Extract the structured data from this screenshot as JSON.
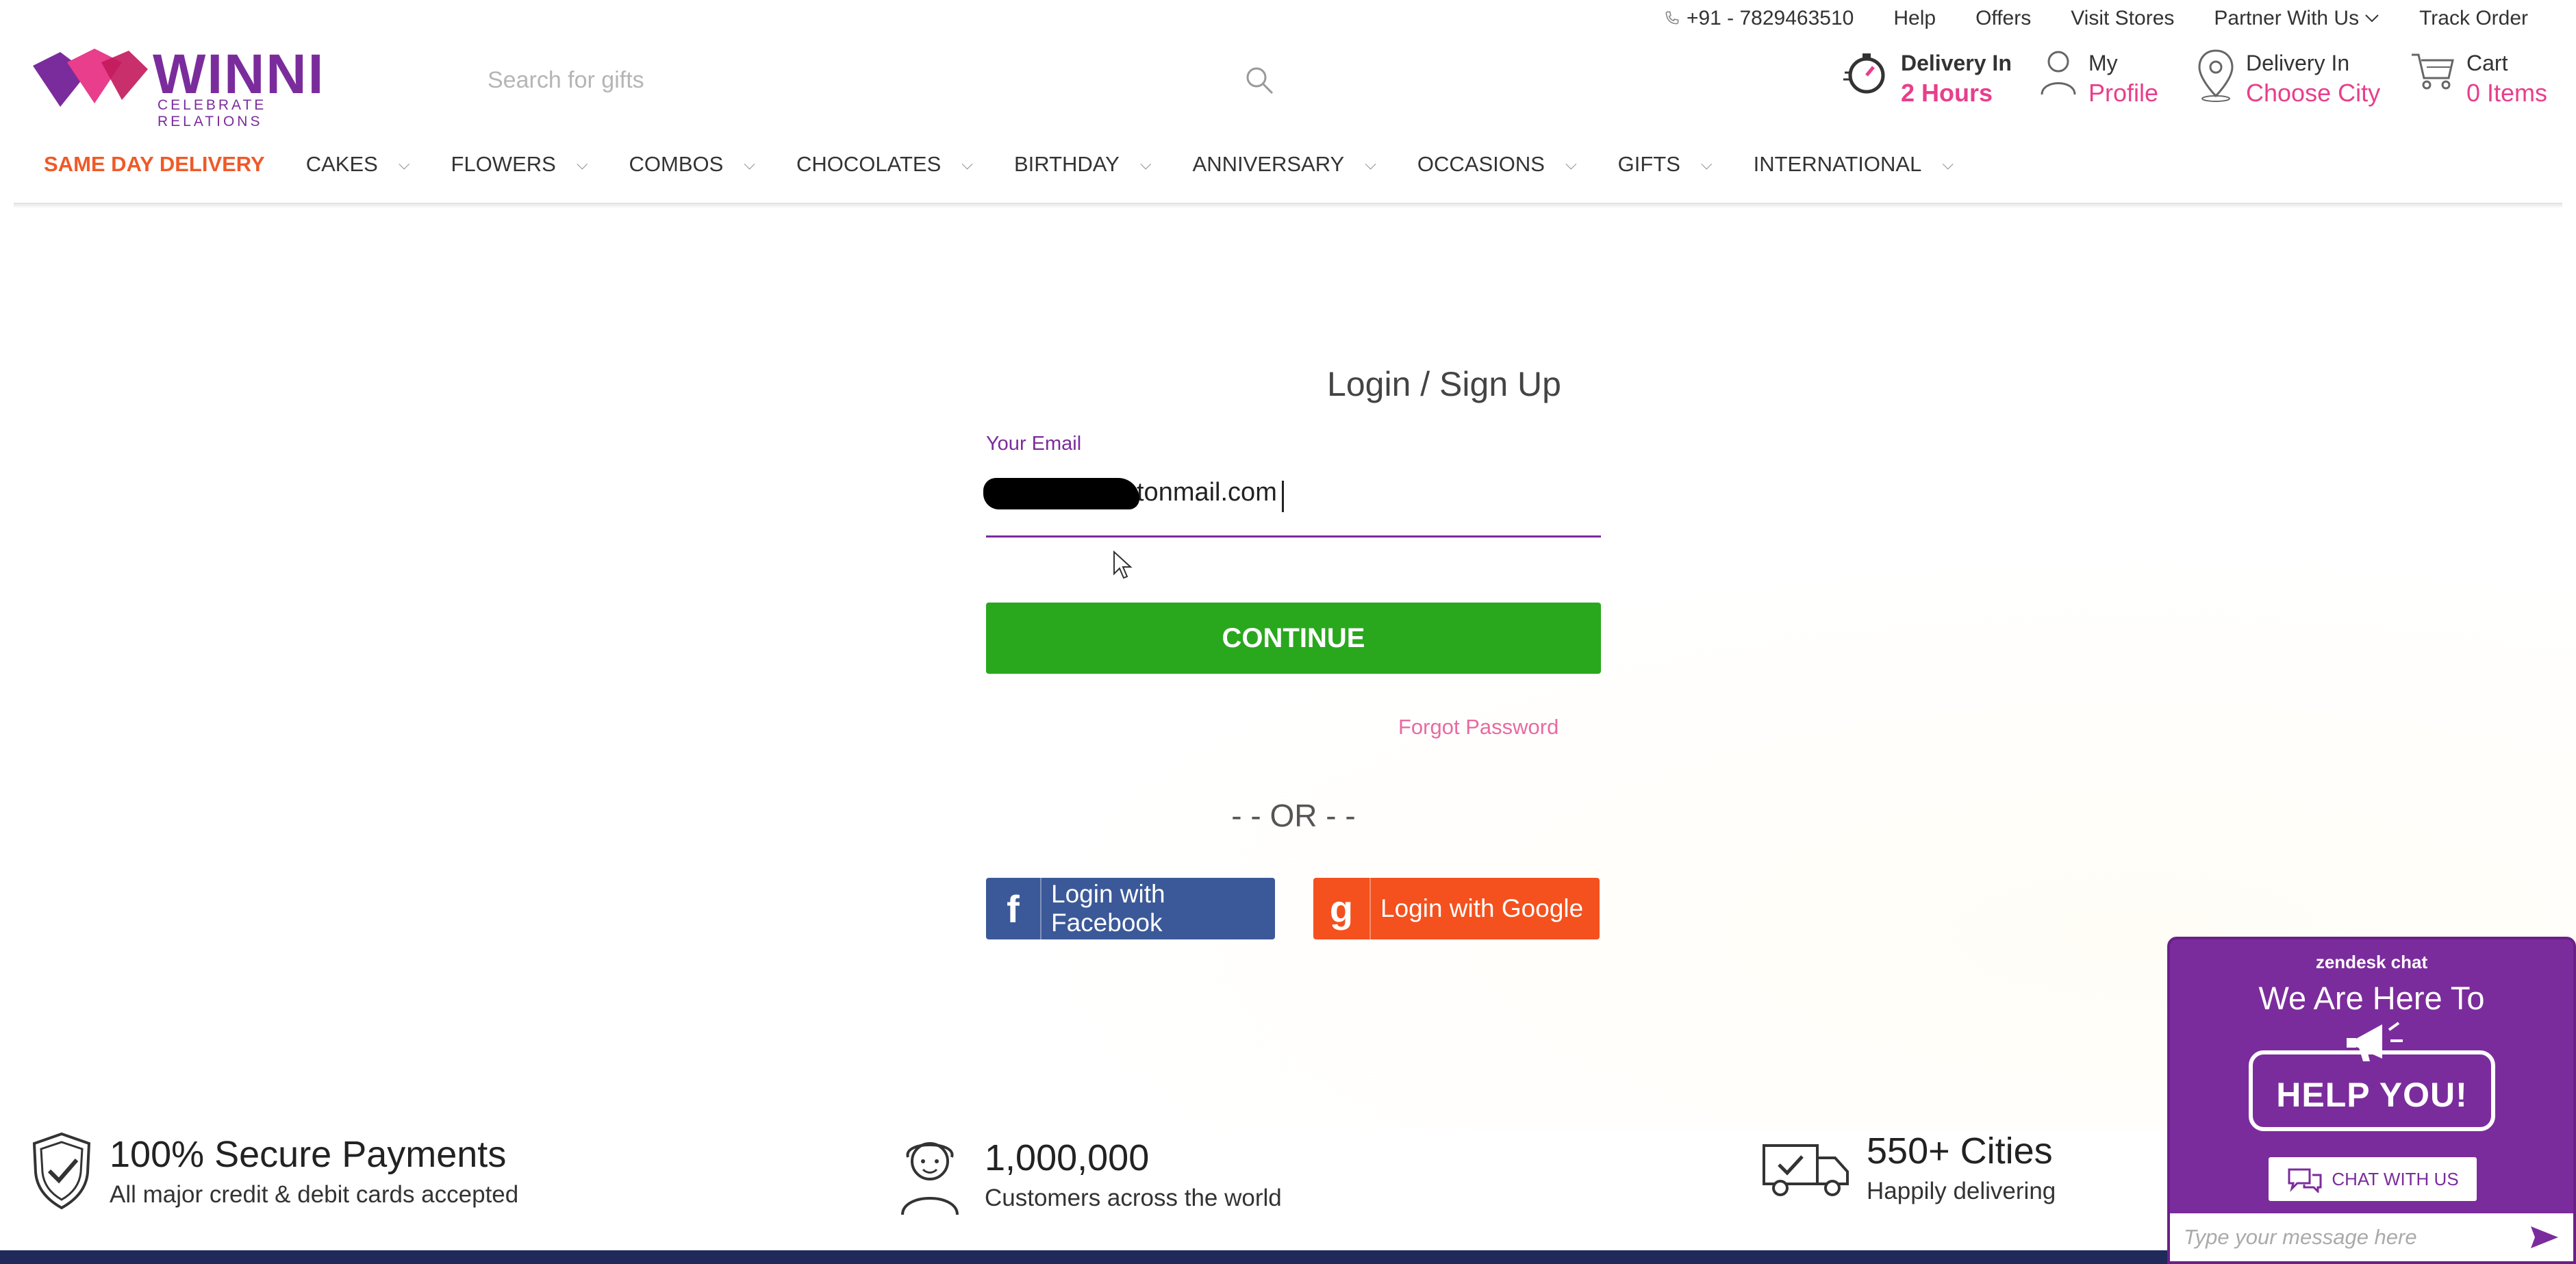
{
  "topbar": {
    "phone": "+91 - 7829463510",
    "links": [
      "Help",
      "Offers",
      "Visit Stores",
      "Partner With Us",
      "Track Order"
    ]
  },
  "logo": {
    "word": "WINNI",
    "tagline": "CELEBRATE RELATIONS"
  },
  "search": {
    "placeholder": "Search for gifts"
  },
  "header": {
    "delivery_time": {
      "line1": "Delivery In",
      "line2": "2 Hours"
    },
    "profile": {
      "line1": "My",
      "line2": "Profile"
    },
    "city": {
      "line1": "Delivery In",
      "line2": "Choose City"
    },
    "cart": {
      "line1": "Cart",
      "line2": "0 Items"
    }
  },
  "nav": {
    "items": [
      "SAME DAY DELIVERY",
      "CAKES",
      "FLOWERS",
      "COMBOS",
      "CHOCOLATES",
      "BIRTHDAY",
      "ANNIVERSARY",
      "OCCASIONS",
      "GIFTS",
      "INTERNATIONAL"
    ]
  },
  "login": {
    "title": "Login / Sign Up",
    "email_label": "Your Email",
    "email_value": "tonmail.com",
    "continue_label": "CONTINUE",
    "forgot_label": "Forgot Password",
    "or_text": "- - OR - -",
    "facebook_label": "Login with Facebook",
    "google_label": "Login with Google"
  },
  "features": [
    {
      "title": "100% Secure Payments",
      "subtitle": "All major credit & debit cards accepted"
    },
    {
      "title": "1,000,000",
      "subtitle": "Customers across the world"
    },
    {
      "title": "550+ Cities",
      "subtitle": "Happily delivering"
    }
  ],
  "zendesk": {
    "brand": "zendesk chat",
    "title": "We Are Here To",
    "badge": "HELP YOU!",
    "chat_label": "CHAT WITH US",
    "input_placeholder": "Type your message here"
  },
  "colors": {
    "brand_purple": "#7b2c9c",
    "accent_pink": "#e83e8c",
    "continue_green": "#29a81d",
    "facebook_blue": "#3b5998",
    "google_orange": "#f4511e",
    "nav_highlight": "#f05a28"
  }
}
